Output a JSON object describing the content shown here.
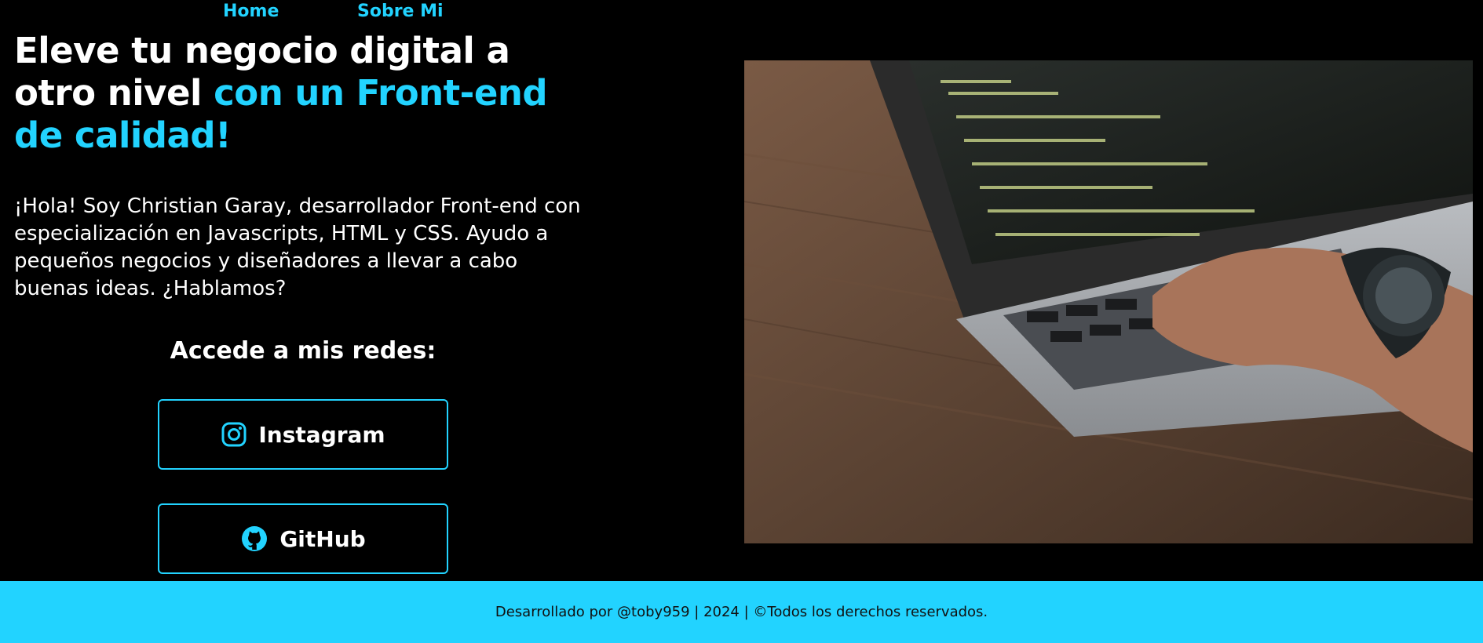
{
  "nav": {
    "home_label": "Home",
    "about_label": "Sobre Mi"
  },
  "hero": {
    "title_part1": "Eleve tu negocio digital a otro nivel",
    "title_accent": "con un Front-end de calidad!",
    "intro": "¡Hola! Soy Christian Garay, desarrollador Front-end con especialización en Javascripts, HTML y CSS. Ayudo a pequeños negocios y diseñadores a llevar a cabo buenas ideas. ¿Hablamos?"
  },
  "socials": {
    "title": "Accede a mis redes:",
    "buttons": [
      {
        "label": "Instagram",
        "icon": "instagram-icon"
      },
      {
        "label": "GitHub",
        "icon": "github-icon"
      }
    ]
  },
  "photo": {
    "subject": "laptop-coding-photo"
  },
  "footer": {
    "text": "Desarrollado por @toby959 | 2024 | ©Todos los derechos reservados."
  },
  "colors": {
    "accent": "#22d3ff",
    "background": "#000000",
    "footer_text": "#111111"
  }
}
